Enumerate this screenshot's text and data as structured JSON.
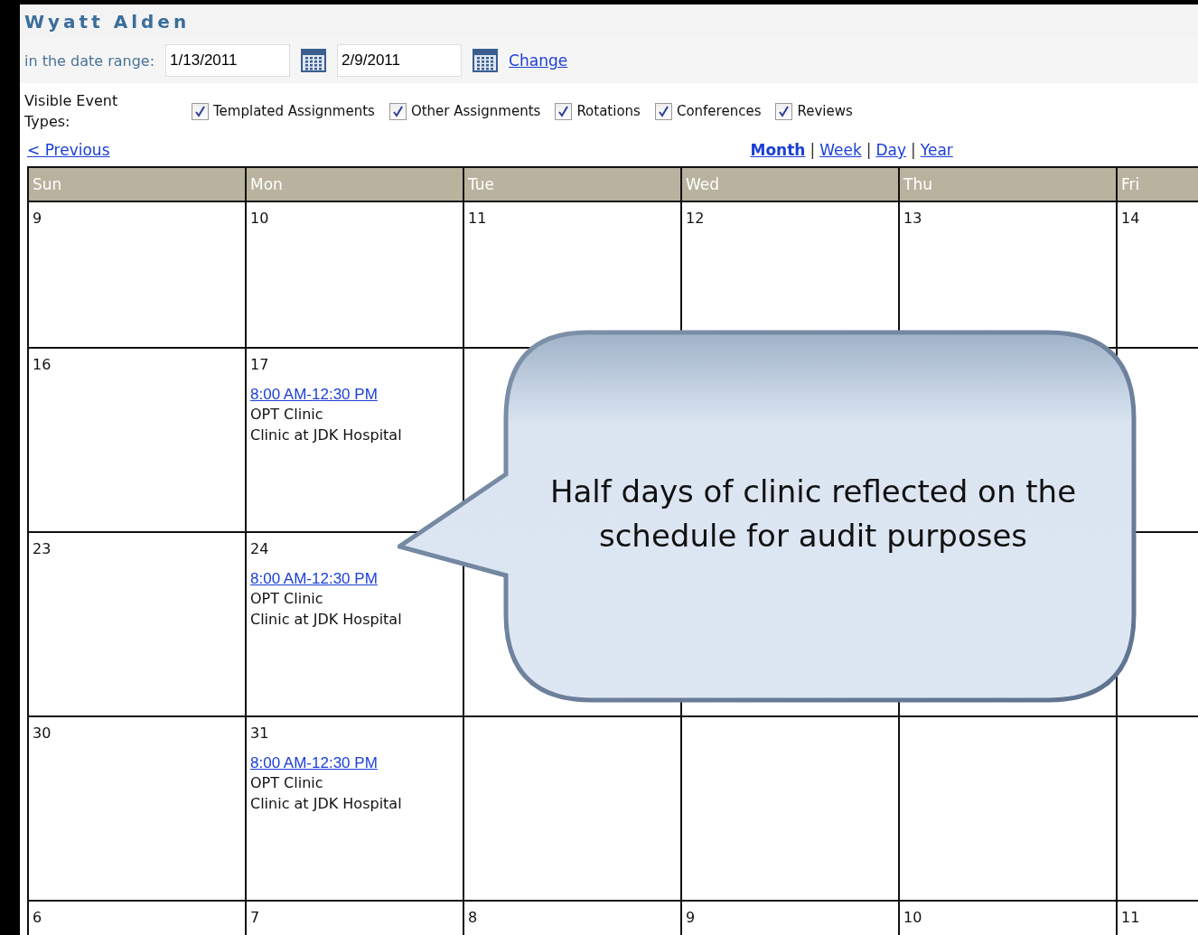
{
  "title": "Wyatt Alden",
  "date_range": {
    "label": "in the date range:",
    "start": "1/13/2011",
    "end": "2/9/2011",
    "change": "Change"
  },
  "event_types": {
    "label": "Visible Event Types:",
    "items": [
      {
        "label": "Templated Assignments",
        "checked": true
      },
      {
        "label": "Other Assignments",
        "checked": true
      },
      {
        "label": "Rotations",
        "checked": true
      },
      {
        "label": "Conferences",
        "checked": true
      },
      {
        "label": "Reviews",
        "checked": true
      }
    ]
  },
  "previous": "< Previous",
  "views": [
    {
      "label": "Month",
      "selected": true
    },
    {
      "separator": "|",
      "label": "Week",
      "selected": false
    },
    {
      "separator": "|",
      "label": "Day",
      "selected": false
    },
    {
      "separator": "|",
      "label": "Year",
      "selected": false
    }
  ],
  "weekdays": [
    "Sun",
    "Mon",
    "Tue",
    "Wed",
    "Thu",
    "Fri"
  ],
  "weeks": [
    {
      "days": [
        {
          "number": "9"
        },
        {
          "number": "10"
        },
        {
          "number": "11"
        },
        {
          "number": "12"
        },
        {
          "number": "13"
        },
        {
          "number": "14"
        }
      ]
    },
    {
      "days": [
        {
          "number": "16"
        },
        {
          "number": "17",
          "events": [
            {
              "time": "8:00 AM-12:30 PM",
              "lines": [
                "OPT Clinic",
                "Clinic at JDK Hospital"
              ]
            }
          ]
        }
      ]
    },
    {
      "days": [
        {
          "number": "23"
        },
        {
          "number": "24",
          "events": [
            {
              "time": "8:00 AM-12:30 PM",
              "lines": [
                "OPT Clinic",
                "Clinic at JDK Hospital"
              ]
            }
          ]
        }
      ]
    },
    {
      "days": [
        {
          "number": "30"
        },
        {
          "number": "31",
          "events": [
            {
              "time": "8:00 AM-12:30 PM",
              "lines": [
                "OPT Clinic",
                "Clinic at JDK Hospital"
              ]
            }
          ]
        }
      ]
    },
    {
      "days": [
        {
          "number": "6"
        },
        {
          "number": "7"
        },
        {
          "number": "8"
        },
        {
          "number": "9"
        },
        {
          "number": "10"
        },
        {
          "number": "11"
        }
      ]
    }
  ],
  "callout": {
    "text": "Half days of clinic reflected on the schedule for audit purposes"
  }
}
